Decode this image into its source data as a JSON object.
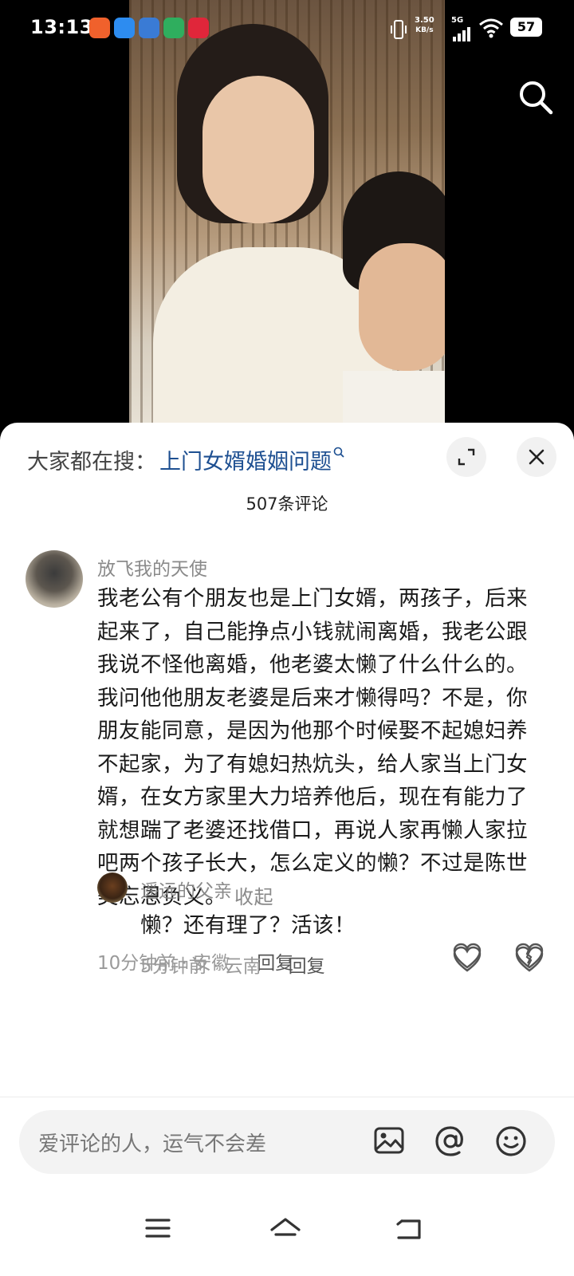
{
  "status_bar": {
    "time": "13:13",
    "net_speed_value": "3.50",
    "net_speed_unit": "KB/s",
    "network": "5G",
    "battery": "57"
  },
  "search": {
    "prefix": "大家都在搜：",
    "term": "上门女婿婚姻问题"
  },
  "comments_header": {
    "count_title": "507条评论"
  },
  "comment": {
    "username": "放飞我的天使",
    "text": "我老公有个朋友也是上门女婿，两孩子，后来起来了，自己能挣点小钱就闹离婚，我老公跟我说不怪他离婚，他老婆太懒了什么什么的。我问他他朋友老婆是后来才懒得吗？不是，你朋友能同意，是因为他那个时候娶不起媳妇养不起家，为了有媳妇热炕头，给人家当上门女婿，在女方家里大力培养他后，现在有能力了就想踹了老婆还找借口，再说人家再懒人家拉吧两个孩子长大，怎么定义的懒？不过是陈世美忘恩负义。",
    "collapse_label": "收起",
    "meta": "10分钟前 · 安徽",
    "reply_label": "回复"
  },
  "reply": {
    "username": "遥远的父亲",
    "text": "懒？还有理了？活该！",
    "meta": "5分钟前 · 云南",
    "reply_label": "回复"
  },
  "input": {
    "placeholder": "爱评论的人，运气不会差"
  },
  "colors": {
    "search_term": "#1d4f91",
    "muted_text": "#8a8a8a",
    "sheet_bg": "#ffffff"
  }
}
